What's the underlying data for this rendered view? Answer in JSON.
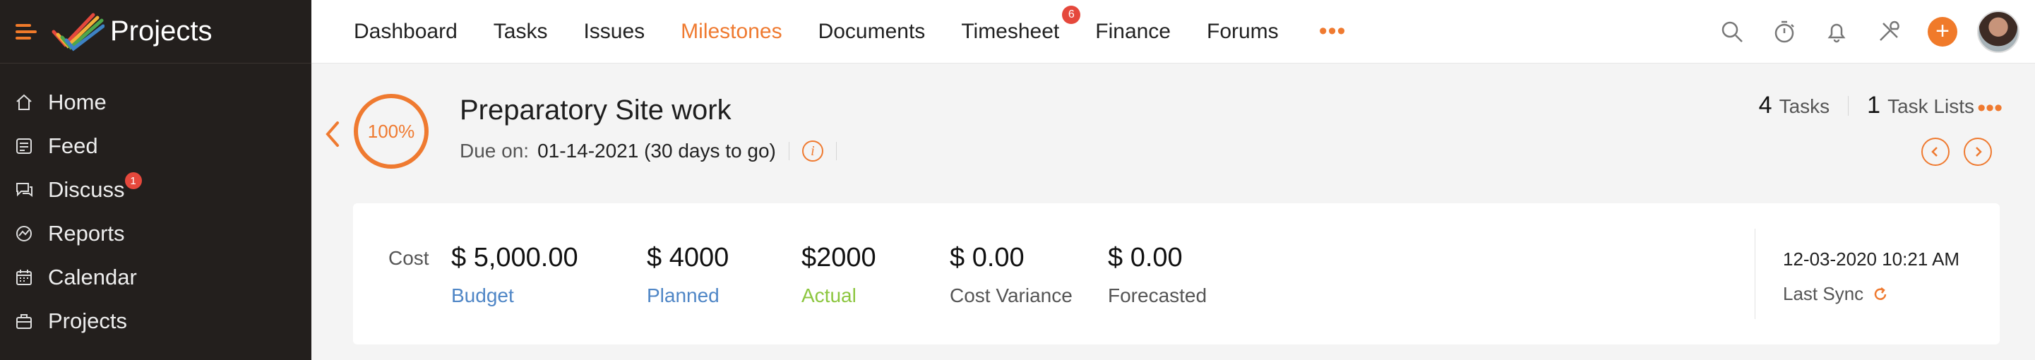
{
  "sidebar": {
    "title": "Projects",
    "items": [
      {
        "label": "Home",
        "icon": "home-icon"
      },
      {
        "label": "Feed",
        "icon": "feed-icon"
      },
      {
        "label": "Discuss",
        "icon": "chat-icon",
        "badge": "1"
      },
      {
        "label": "Reports",
        "icon": "reports-icon"
      },
      {
        "label": "Calendar",
        "icon": "calendar-icon"
      },
      {
        "label": "Projects",
        "icon": "briefcase-icon"
      }
    ]
  },
  "topnav": {
    "tabs": [
      {
        "label": "Dashboard"
      },
      {
        "label": "Tasks"
      },
      {
        "label": "Issues"
      },
      {
        "label": "Milestones",
        "active": true
      },
      {
        "label": "Documents"
      },
      {
        "label": "Timesheet",
        "badge": "6"
      },
      {
        "label": "Finance"
      },
      {
        "label": "Forums"
      }
    ],
    "more": "•••",
    "tools": [
      "search-icon",
      "timer-icon",
      "bell-icon",
      "tools-icon",
      "plus-icon",
      "avatar"
    ]
  },
  "milestone": {
    "progress": "100%",
    "title": "Preparatory Site work",
    "due_label": "Due on:",
    "due_value": "01-14-2021 (30 days to go)",
    "tasks_count": "4",
    "tasks_label": "Tasks",
    "tasklists_count": "1",
    "tasklists_label": "Task Lists",
    "more": "•••"
  },
  "cost": {
    "label": "Cost",
    "metrics": [
      {
        "amount": "$ 5,000.00",
        "label": "Budget",
        "color": "#4f86c6"
      },
      {
        "amount": "$ 4000",
        "label": "Planned",
        "color": "#4f86c6"
      },
      {
        "amount": "$2000",
        "label": "Actual",
        "color": "#8cc63f"
      },
      {
        "amount": "$ 0.00",
        "label": "Cost Variance",
        "color": "#555555"
      },
      {
        "amount": "$ 0.00",
        "label": "Forecasted",
        "color": "#555555"
      }
    ],
    "sync_time": "12-03-2020 10:21 AM",
    "sync_label": "Last Sync"
  },
  "colors": {
    "accent": "#ef7a30",
    "sidebar_bg": "#231f1d",
    "badge": "#e5483c"
  }
}
